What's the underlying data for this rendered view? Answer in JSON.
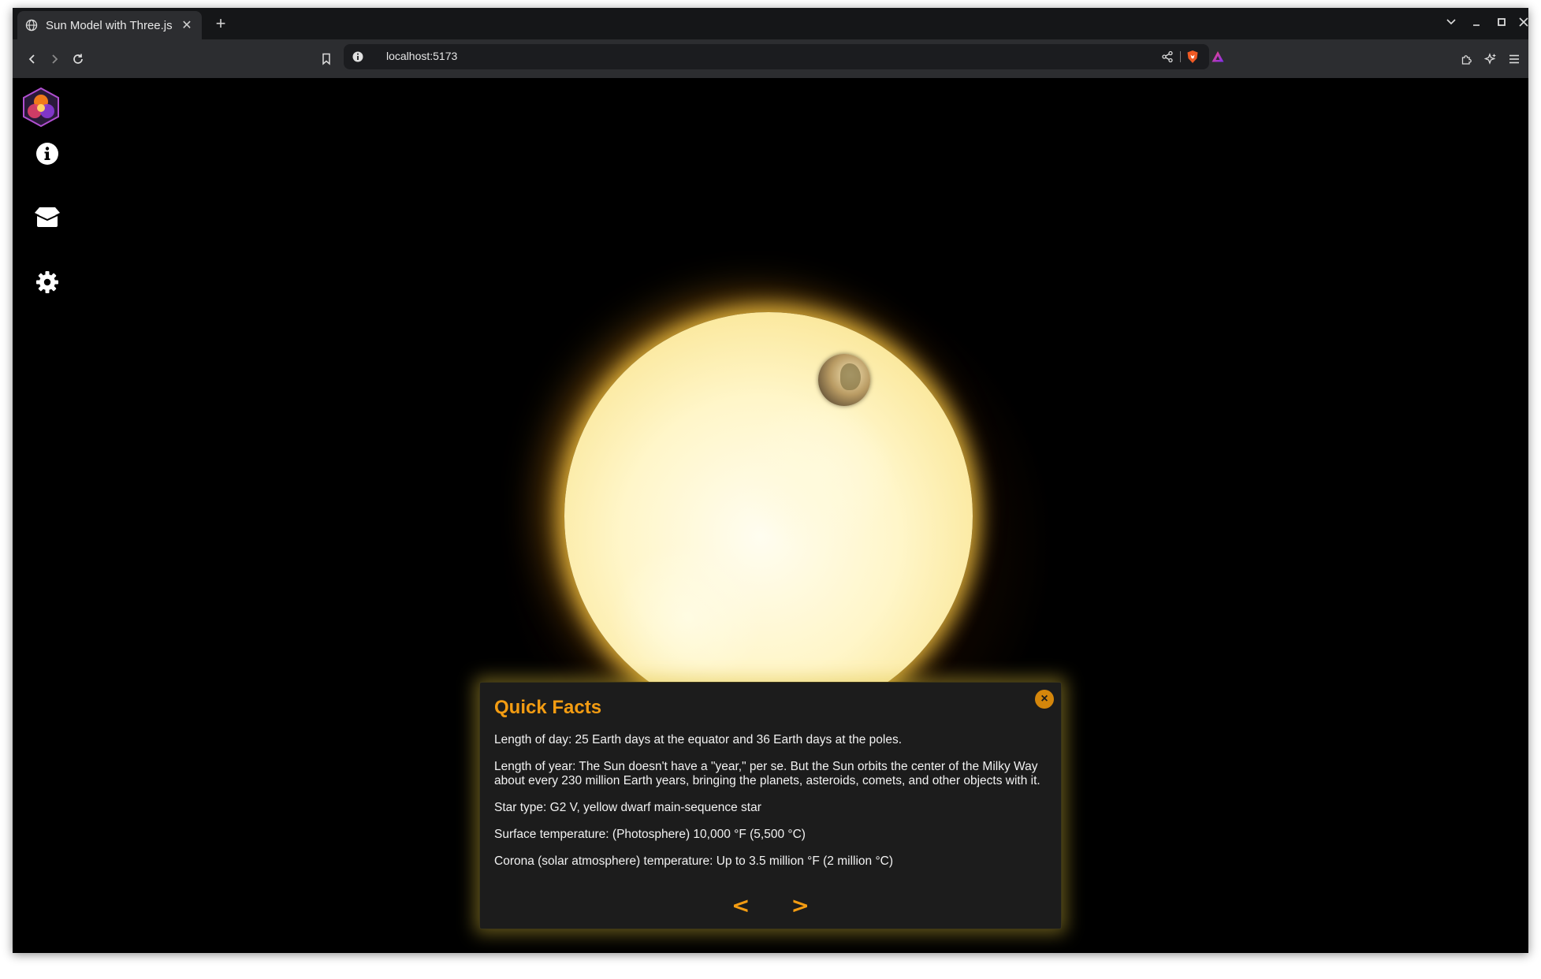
{
  "browser": {
    "tab_title": "Sun Model with Three.js",
    "url": "localhost:5173"
  },
  "sidebar": {
    "items": [
      {
        "name": "info",
        "icon": "info-icon"
      },
      {
        "name": "box",
        "icon": "box-icon"
      },
      {
        "name": "settings",
        "icon": "gear-icon"
      }
    ]
  },
  "facts": {
    "title": "Quick Facts",
    "items": [
      "Length of day: 25 Earth days at the equator and 36 Earth days at the poles.",
      "Length of year: The Sun doesn't have a \"year,\" per se. But the Sun orbits the center of the Milky Way about every 230 million Earth years, bringing the planets, asteroids, comets, and other objects with it.",
      "Star type: G2 V, yellow dwarf main-sequence star",
      "Surface temperature: (Photosphere) 10,000 °F (5,500 °C)",
      "Corona (solar atmosphere) temperature: Up to 3.5 million °F (2 million °C)"
    ],
    "prev_label": "<",
    "next_label": ">",
    "close_label": "×"
  },
  "colors": {
    "accent": "#f39c12",
    "panel_bg": "#1c1c1c",
    "page_bg": "#000000"
  }
}
